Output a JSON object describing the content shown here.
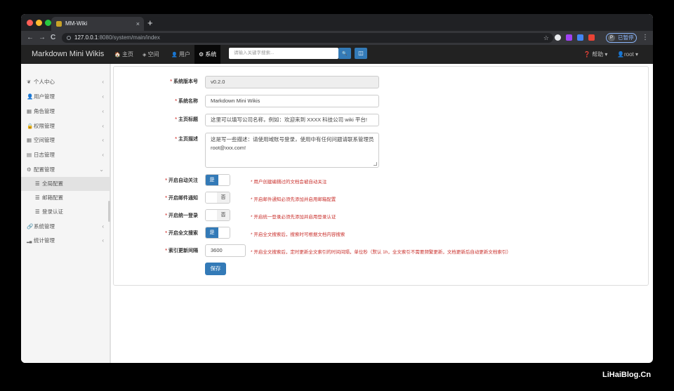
{
  "browser": {
    "tab_title": "MM-Wiki",
    "tab_close": "×",
    "new_tab": "+",
    "url_host": "127.0.0.1",
    "url_rest": ":8080/system/main/index",
    "profile_initial": "P",
    "profile_label": "已暂停",
    "back": "←",
    "forward": "→",
    "reload": "C",
    "star": "☆",
    "menu": "⋮"
  },
  "navbar": {
    "brand": "Markdown Mini Wikis",
    "items": [
      {
        "icon": "home-icon",
        "glyph": "🏠",
        "label": "主页"
      },
      {
        "icon": "space-icon",
        "glyph": "◈",
        "label": "空间"
      },
      {
        "icon": "user-icon",
        "glyph": "👤",
        "label": "用户"
      },
      {
        "icon": "gear-icon",
        "glyph": "⚙",
        "label": "系统"
      }
    ],
    "search_placeholder": "请输入关键字搜索...",
    "search_icon": "🔍",
    "layout_icon": "◫",
    "help_label": "帮助 ▾",
    "user_label": "root ▾"
  },
  "sidebar": {
    "items": [
      {
        "icon": "leaf-icon",
        "glyph": "❦",
        "label": "个人中心",
        "chevron": "‹"
      },
      {
        "icon": "user-icon",
        "glyph": "👤",
        "label": "用户管理",
        "chevron": "‹"
      },
      {
        "icon": "grid-icon",
        "glyph": "▦",
        "label": "角色管理",
        "chevron": "‹"
      },
      {
        "icon": "lock-icon",
        "glyph": "🔒",
        "label": "权限管理",
        "chevron": "‹"
      },
      {
        "icon": "grid-icon",
        "glyph": "▦",
        "label": "空间管理",
        "chevron": "‹"
      },
      {
        "icon": "calendar-icon",
        "glyph": "▤",
        "label": "日志管理",
        "chevron": "‹"
      },
      {
        "icon": "gear-icon",
        "glyph": "⚙",
        "label": "配置管理",
        "chevron": "⌄"
      },
      {
        "icon": "list-icon",
        "glyph": "☰",
        "label": "全局配置",
        "chevron": ""
      },
      {
        "icon": "list-icon",
        "glyph": "☰",
        "label": "邮箱配置",
        "chevron": ""
      },
      {
        "icon": "list-icon",
        "glyph": "☰",
        "label": "登录认证",
        "chevron": ""
      },
      {
        "icon": "link-icon",
        "glyph": "🔗",
        "label": "系统管理",
        "chevron": "‹"
      },
      {
        "icon": "bar-chart-icon",
        "glyph": "▂▄",
        "label": "统计管理",
        "chevron": "‹"
      }
    ]
  },
  "form": {
    "required_mark": "*",
    "version_label": "系统版本号",
    "version_value": "v0.2.0",
    "name_label": "系统名称",
    "name_value": "Markdown Mini Wikis",
    "title_label": "主页标题",
    "title_value": "这里可以填写公司名称，例如：欢迎来到 XXXX 科技公司 wiki 平台!",
    "desc_label": "主页描述",
    "desc_value": "这是写一些描述：请使用域账号登录，使用中有任何问题请联系管理员 root@xxx.com!",
    "auto_follow_label": "开启自动关注",
    "auto_follow_state": "是",
    "auto_follow_hint": "* 用户创建编辑过的文档会被自动关注",
    "mail_label": "开启邮件通知",
    "mail_state": "否",
    "mail_hint": "* 开启邮件通知必须先添加并启用邮箱配置",
    "sso_label": "开启统一登录",
    "sso_state": "否",
    "sso_hint": "* 开启统一登录必须先添加并启用登录认证",
    "fulltext_label": "开启全文搜索",
    "fulltext_state": "是",
    "fulltext_hint": "* 开启全文搜索后，搜索时可根据文档内容搜索",
    "interval_label": "索引更新间隔",
    "interval_value": "3600",
    "interval_hint": "* 开启全文搜索后，定时更新全文索引的时间间隔，单位秒（默认 1h，全文索引不需要频繁更新，文档更新后自动更新文档索引）",
    "save_label": "保存"
  },
  "watermark": "LiHaiBlog.Cn"
}
